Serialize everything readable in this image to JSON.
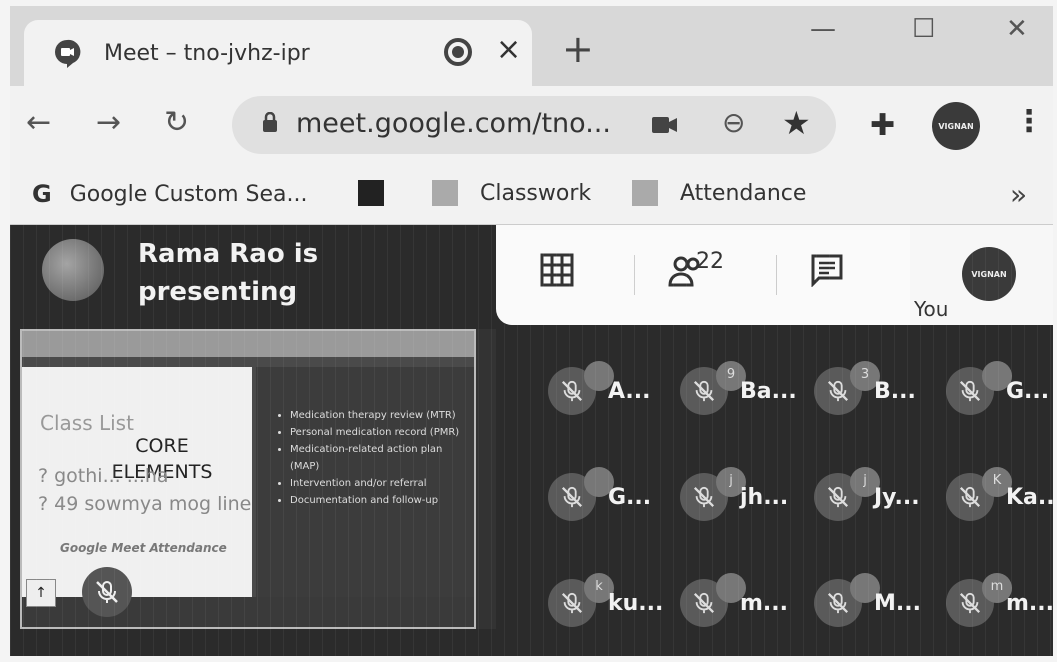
{
  "browser": {
    "tab_title": "Meet – tno-jvhz-ipr",
    "url": "meet.google.com/tno...",
    "bookmarks": [
      {
        "label": "Google Custom Sea...",
        "icon": "google-g-icon"
      },
      {
        "label": "",
        "icon": "image-bookmark-icon"
      },
      {
        "label": "Classwork",
        "icon": "document-icon"
      },
      {
        "label": "Attendance",
        "icon": "document-icon"
      }
    ],
    "bookmarks_more": "»",
    "window_controls": {
      "minimize": "—",
      "maximize": "☐",
      "close": "✕"
    },
    "new_tab": "+",
    "tab_close": "×"
  },
  "meet": {
    "presenter_text": "Rama Rao is presenting",
    "participant_count": "22",
    "self_label": "You",
    "avatar_text": "VIGNAN",
    "shared_screen": {
      "class_list": "Class List",
      "core_label": "CORE ELEMENTS",
      "list_rows": [
        "? gothi... ...ha",
        "? 49 sowmya mog line"
      ],
      "footer": "Google Meet Attendance",
      "slide_bullets": [
        "Medication therapy review (MTR)",
        "Personal medication record (PMR)",
        "Medication-related action plan (MAP)",
        "Intervention and/or referral",
        "Documentation and follow-up"
      ]
    },
    "tiles": [
      {
        "name": "A...",
        "bubble": ""
      },
      {
        "name": "Ba...",
        "bubble": "9"
      },
      {
        "name": "B...",
        "bubble": "3"
      },
      {
        "name": "G...",
        "bubble": ""
      },
      {
        "name": "G...",
        "bubble": ""
      },
      {
        "name": "jh...",
        "bubble": "j"
      },
      {
        "name": "Jy...",
        "bubble": "j"
      },
      {
        "name": "Ka...",
        "bubble": "K"
      },
      {
        "name": "ku...",
        "bubble": "k"
      },
      {
        "name": "m...",
        "bubble": ""
      },
      {
        "name": "M...",
        "bubble": ""
      },
      {
        "name": "m...",
        "bubble": "m"
      }
    ]
  }
}
